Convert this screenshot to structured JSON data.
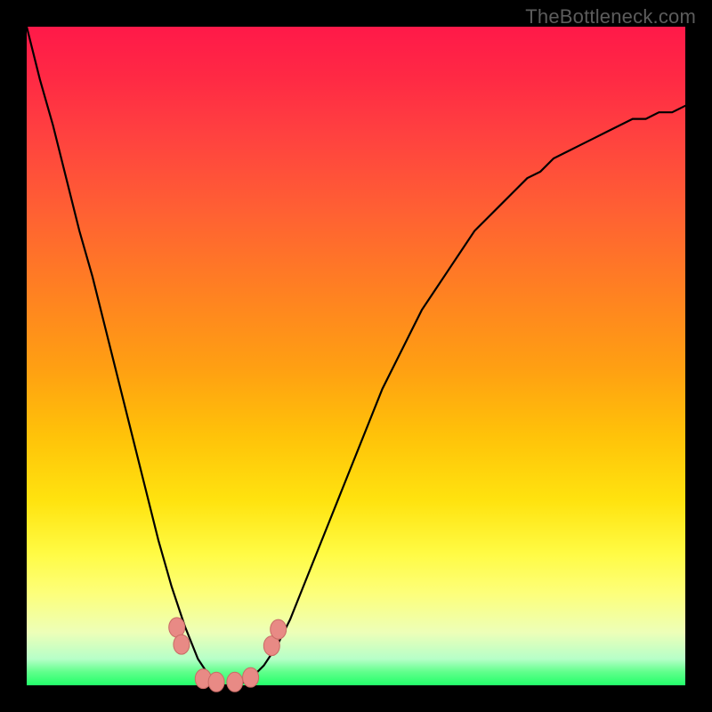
{
  "watermark": {
    "text": "TheBottleneck.com"
  },
  "chart_data": {
    "type": "line",
    "title": "",
    "xlabel": "",
    "ylabel": "",
    "x": [
      0.0,
      0.02,
      0.04,
      0.06,
      0.08,
      0.1,
      0.12,
      0.14,
      0.16,
      0.18,
      0.2,
      0.22,
      0.24,
      0.26,
      0.28,
      0.3,
      0.32,
      0.34,
      0.36,
      0.38,
      0.4,
      0.42,
      0.44,
      0.46,
      0.48,
      0.5,
      0.52,
      0.54,
      0.56,
      0.58,
      0.6,
      0.62,
      0.64,
      0.66,
      0.68,
      0.7,
      0.72,
      0.74,
      0.76,
      0.78,
      0.8,
      0.82,
      0.84,
      0.86,
      0.88,
      0.9,
      0.92,
      0.94,
      0.96,
      0.98,
      1.0
    ],
    "values": [
      1.0,
      0.92,
      0.85,
      0.77,
      0.69,
      0.62,
      0.54,
      0.46,
      0.38,
      0.3,
      0.22,
      0.15,
      0.09,
      0.04,
      0.01,
      0.0,
      0.0,
      0.01,
      0.03,
      0.06,
      0.1,
      0.15,
      0.2,
      0.25,
      0.3,
      0.35,
      0.4,
      0.45,
      0.49,
      0.53,
      0.57,
      0.6,
      0.63,
      0.66,
      0.69,
      0.71,
      0.73,
      0.75,
      0.77,
      0.78,
      0.8,
      0.81,
      0.82,
      0.83,
      0.84,
      0.85,
      0.86,
      0.86,
      0.87,
      0.87,
      0.88
    ],
    "xlim": [
      0,
      1
    ],
    "ylim": [
      0,
      1
    ],
    "annotations": [
      {
        "type": "bead",
        "x": 0.228,
        "y": 0.088
      },
      {
        "type": "bead",
        "x": 0.235,
        "y": 0.062
      },
      {
        "type": "bead",
        "x": 0.268,
        "y": 0.01
      },
      {
        "type": "bead",
        "x": 0.288,
        "y": 0.005
      },
      {
        "type": "bead",
        "x": 0.316,
        "y": 0.005
      },
      {
        "type": "bead",
        "x": 0.34,
        "y": 0.012
      },
      {
        "type": "bead",
        "x": 0.372,
        "y": 0.06
      },
      {
        "type": "bead",
        "x": 0.382,
        "y": 0.085
      }
    ],
    "background_gradient": {
      "top": "#ff1949",
      "mid": "#ffe30f",
      "bottom": "#23ff6a"
    }
  },
  "colors": {
    "frame": "#000000",
    "curve": "#000000",
    "bead_fill": "#e88a85",
    "bead_stroke": "#c96b66"
  }
}
